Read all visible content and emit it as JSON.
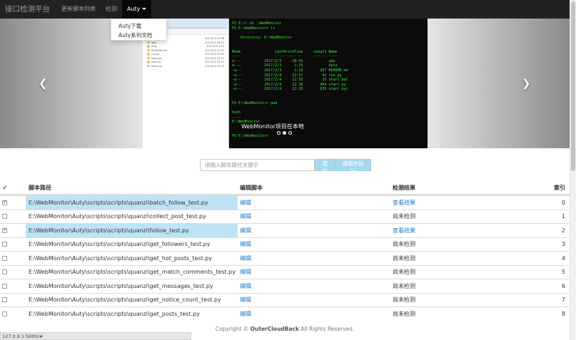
{
  "navbar": {
    "brand": "接口检测平台",
    "links": [
      "更新脚本列表",
      "检测"
    ],
    "active_menu": "Auty"
  },
  "dropdown": {
    "items": [
      "Auty下载",
      "Auty系列文档"
    ]
  },
  "carousel": {
    "caption": "WebMonitor项目在本地",
    "explorer_files": [
      {
        "name": ".git",
        "date": "2017/2/3 17:56"
      },
      {
        "name": "app",
        "date": "2017/2/3 18:43"
      },
      {
        "name": "Auty",
        "date": "2017/2/3 1:19"
      },
      {
        "name": "README.md",
        "date": "2017/2/4 12:57"
      },
      {
        "name": "run.py",
        "date": "2017/2/4 12:59"
      },
      {
        "name": "start.pyc",
        "date": "2017/2/4 22:19"
      },
      {
        "name": "start.py",
        "date": "2017/2/4 22:10"
      },
      {
        "name": "start.pyc",
        "date": "2017/2/4 22:20"
      }
    ],
    "terminal_lines": [
      "PS E:\\> cd .\\WebMonitor",
      "PS E:\\WebMonitor> ls",
      "",
      "    Directory: E:\\WebMonitor",
      "",
      "",
      "Mode                LastWriteTime     Length Name",
      "----                -------------     ------ ----",
      "d----          2017/2/3     18:43            app",
      "d----          2017/2/3      1:19            Auty",
      "-a---          2017/2/3      1:19        267 README.md",
      "-a---          2017/2/4     12:57         42 run.py",
      "-a---          2017/2/4     12:59         35 start.bat",
      "-a---          2017/2/4     22:10        404 start.py",
      "-a---          2017/2/4     22:20        830 start.pyc",
      "",
      "",
      "PS E:\\WebMonitor> pwd",
      "",
      "Path",
      "----",
      "E:\\WebMonitor",
      "",
      "",
      "PS E:\\WebMonitor>"
    ]
  },
  "search": {
    "placeholder": "请输入脚本路径关键字",
    "search_label": "搜索",
    "execute_label": "搜索并执行"
  },
  "table": {
    "headers": {
      "path": "脚本路径",
      "edit": "编辑脚本",
      "result": "检测结果",
      "index": "索引"
    },
    "rows": [
      {
        "checked": true,
        "path": "E:\\WebMonitor\\Auty\\scripts\\scripts\\quanzi\\batch_follow_test.py",
        "edit": "编辑",
        "result": "查看结果",
        "result_is_link": true,
        "index": "0"
      },
      {
        "checked": false,
        "path": "E:\\WebMonitor\\Auty\\scripts\\scripts\\quanzi\\collect_post_test.py",
        "edit": "编辑",
        "result": "尚未检测",
        "result_is_link": false,
        "index": "1"
      },
      {
        "checked": true,
        "path": "E:\\WebMonitor\\Auty\\scripts\\scripts\\quanzi\\follow_test.py",
        "edit": "编辑",
        "result": "查看结果",
        "result_is_link": true,
        "index": "2"
      },
      {
        "checked": false,
        "path": "E:\\WebMonitor\\Auty\\scripts\\scripts\\quanzi\\get_followers_test.py",
        "edit": "编辑",
        "result": "尚未检测",
        "result_is_link": false,
        "index": "3"
      },
      {
        "checked": false,
        "path": "E:\\WebMonitor\\Auty\\scripts\\scripts\\quanzi\\get_hot_posts_test.py",
        "edit": "编辑",
        "result": "尚未检测",
        "result_is_link": false,
        "index": "4"
      },
      {
        "checked": false,
        "path": "E:\\WebMonitor\\Auty\\scripts\\scripts\\quanzi\\get_match_comments_test.py",
        "edit": "编辑",
        "result": "尚未检测",
        "result_is_link": false,
        "index": "5"
      },
      {
        "checked": false,
        "path": "E:\\WebMonitor\\Auty\\scripts\\scripts\\quanzi\\get_messages_test.py",
        "edit": "编辑",
        "result": "尚未检测",
        "result_is_link": false,
        "index": "6"
      },
      {
        "checked": false,
        "path": "E:\\WebMonitor\\Auty\\scripts\\scripts\\quanzi\\get_notice_count_test.py",
        "edit": "编辑",
        "result": "尚未检测",
        "result_is_link": false,
        "index": "7"
      },
      {
        "checked": false,
        "path": "E:\\WebMonitor\\Auty\\scripts\\scripts\\quanzi\\get_posts_test.py",
        "edit": "编辑",
        "result": "尚未检测",
        "result_is_link": false,
        "index": "8"
      }
    ]
  },
  "footer": {
    "prefix": "Copyright ©",
    "owner": "OuterCloudBack",
    "suffix": "All Rights Reserved."
  },
  "status_url": "127.0.0.1:5000/#",
  "colors": {
    "navbar": "#222222",
    "link": "#2b7ab9",
    "selected_row": "#bde4f5",
    "search_button": "#a8d7ec",
    "terminal_text": "#3ce23c"
  },
  "icons": [
    "chevron-left-icon",
    "chevron-right-icon",
    "check-all-icon",
    "caret-down-icon",
    "folder-icon"
  ]
}
